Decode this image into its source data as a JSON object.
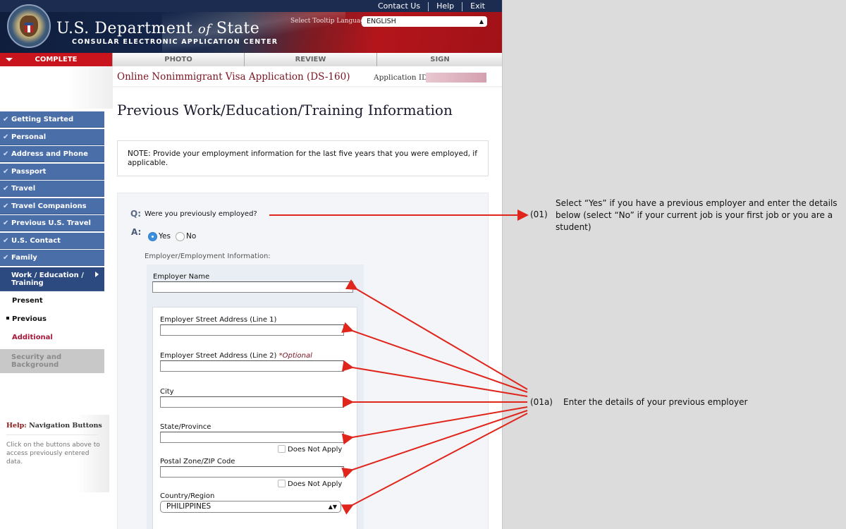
{
  "header": {
    "dept_title_1": "U.S. Department",
    "dept_title_of": "of",
    "dept_title_2": "State",
    "dept_subtitle": "CONSULAR ELECTRONIC APPLICATION CENTER",
    "top_links": [
      "Contact Us",
      "Help",
      "Exit"
    ],
    "tooltip_language_label": "Select Tooltip Language",
    "tooltip_language_value": "ENGLISH"
  },
  "tabs": [
    {
      "label": "COMPLETE",
      "active": true
    },
    {
      "label": "PHOTO",
      "active": false
    },
    {
      "label": "REVIEW",
      "active": false
    },
    {
      "label": "SIGN",
      "active": false
    }
  ],
  "application": {
    "title": "Online Nonimmigrant Visa Application (DS-160)",
    "id_label": "Application ID",
    "id_value": ""
  },
  "sidebar": {
    "completed_items": [
      "Getting Started",
      "Personal",
      "Address and Phone",
      "Passport",
      "Travel",
      "Travel Companions",
      "Previous U.S. Travel",
      "U.S. Contact",
      "Family"
    ],
    "current_item": "Work / Education / Training",
    "sub_items": [
      {
        "label": "Present",
        "state": "done"
      },
      {
        "label": "Previous",
        "state": "current"
      },
      {
        "label": "Additional",
        "state": "pending"
      }
    ],
    "disabled_item": "Security and Background",
    "help": {
      "prefix": "Help:",
      "title": "Navigation Buttons",
      "text": "Click on the buttons above to access previously entered data."
    }
  },
  "main": {
    "page_title": "Previous Work/Education/Training Information",
    "note": "NOTE: Provide your employment information for the last five years that you were employed, if applicable.",
    "question": {
      "q_label": "Q:",
      "text": "Were you previously employed?",
      "a_label": "A:",
      "options": [
        "Yes",
        "No"
      ],
      "selected": "Yes"
    },
    "employment_section_label": "Employer/Employment Information:",
    "fields": {
      "employer_name": {
        "label": "Employer Name",
        "value": ""
      },
      "street1": {
        "label": "Employer Street Address (Line 1)",
        "value": ""
      },
      "street2": {
        "label": "Employer Street Address (Line 2)",
        "optional": "*Optional",
        "value": ""
      },
      "city": {
        "label": "City",
        "value": ""
      },
      "state": {
        "label": "State/Province",
        "value": "",
        "does_not_apply": "Does Not Apply"
      },
      "postal": {
        "label": "Postal Zone/ZIP Code",
        "value": "",
        "does_not_apply": "Does Not Apply"
      },
      "country": {
        "label": "Country/Region",
        "value": "PHILIPPINES"
      }
    }
  },
  "annotations": [
    {
      "number": "(01)",
      "text": "Select “Yes” if you have a previous employer and enter the details below (select “No” if your current job is your first job or you are a student)"
    },
    {
      "number": "(01a)",
      "text": "Enter the details of your previous employer"
    }
  ],
  "colors": {
    "nav_blue": "#4a6ea8",
    "nav_current": "#2c4a80",
    "tab_active_red": "#c8141c",
    "arrow_red": "#e0261c",
    "title_maroon": "#7a1420"
  }
}
